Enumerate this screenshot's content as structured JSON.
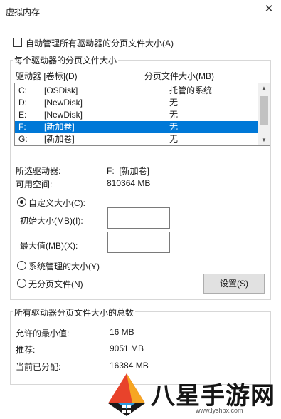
{
  "window": {
    "title": "虚拟内存",
    "close_icon": "close-icon"
  },
  "auto_manage": {
    "label": "自动管理所有驱动器的分页文件大小(A)",
    "checked": false
  },
  "per_drive": {
    "group_title": "每个驱动器的分页文件大小",
    "col_drive": "驱动器 [卷标](D)",
    "col_size": "分页文件大小(MB)",
    "drives": [
      {
        "letter": "C:",
        "label": "[OSDisk]",
        "size": "托管的系统"
      },
      {
        "letter": "D:",
        "label": "[NewDisk]",
        "size": "无"
      },
      {
        "letter": "E:",
        "label": "[NewDisk]",
        "size": "无"
      },
      {
        "letter": "F:",
        "label": "[新加卷]",
        "size": "无"
      },
      {
        "letter": "G:",
        "label": "[新加卷]",
        "size": "无"
      }
    ],
    "selected_index": 3,
    "selected_drive_label": "所选驱动器:",
    "selected_drive_value": "F:  [新加卷]",
    "free_space_label": "可用空间:",
    "free_space_value": "810364 MB",
    "custom_size_label": "自定义大小(C):",
    "initial_size_label": "初始大小(MB)(I):",
    "initial_size_value": "",
    "max_size_label": "最大值(MB)(X):",
    "max_size_value": "",
    "system_managed_label": "系统管理的大小(Y)",
    "no_paging_label": "无分页文件(N)",
    "selected_option": "custom",
    "set_button": "设置(S)"
  },
  "totals": {
    "group_title": "所有驱动器分页文件大小的总数",
    "min_label": "允许的最小值:",
    "min_value": "16 MB",
    "recommended_label": "推荐:",
    "recommended_value": "9051 MB",
    "current_label": "当前已分配:",
    "current_value": "16384 MB"
  },
  "watermark": {
    "text": "八星手游网",
    "url": "www.lyshbx.com"
  }
}
